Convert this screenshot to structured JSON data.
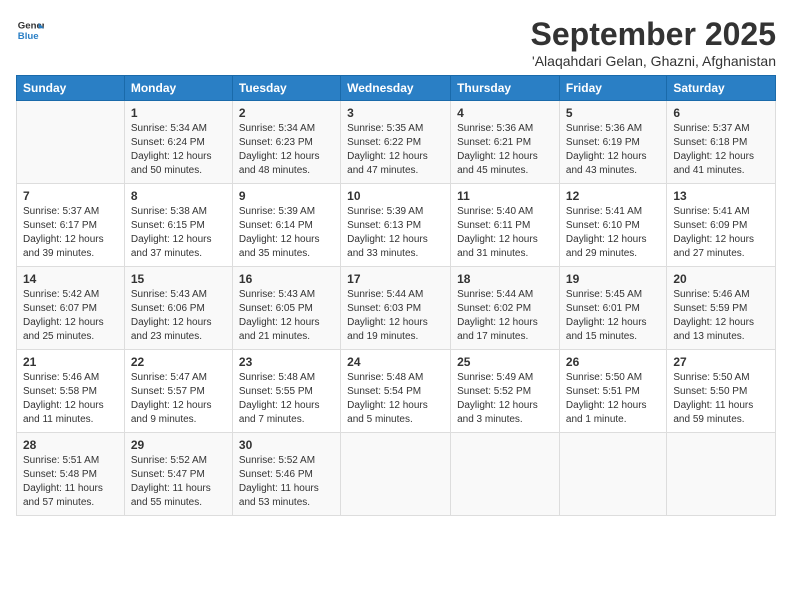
{
  "logo": {
    "line1": "General",
    "line2": "Blue"
  },
  "title": "September 2025",
  "location": "'Alaqahdari Gelan, Ghazni, Afghanistan",
  "days_of_week": [
    "Sunday",
    "Monday",
    "Tuesday",
    "Wednesday",
    "Thursday",
    "Friday",
    "Saturday"
  ],
  "weeks": [
    [
      {
        "day": "",
        "content": ""
      },
      {
        "day": "1",
        "content": "Sunrise: 5:34 AM\nSunset: 6:24 PM\nDaylight: 12 hours\nand 50 minutes."
      },
      {
        "day": "2",
        "content": "Sunrise: 5:34 AM\nSunset: 6:23 PM\nDaylight: 12 hours\nand 48 minutes."
      },
      {
        "day": "3",
        "content": "Sunrise: 5:35 AM\nSunset: 6:22 PM\nDaylight: 12 hours\nand 47 minutes."
      },
      {
        "day": "4",
        "content": "Sunrise: 5:36 AM\nSunset: 6:21 PM\nDaylight: 12 hours\nand 45 minutes."
      },
      {
        "day": "5",
        "content": "Sunrise: 5:36 AM\nSunset: 6:19 PM\nDaylight: 12 hours\nand 43 minutes."
      },
      {
        "day": "6",
        "content": "Sunrise: 5:37 AM\nSunset: 6:18 PM\nDaylight: 12 hours\nand 41 minutes."
      }
    ],
    [
      {
        "day": "7",
        "content": "Sunrise: 5:37 AM\nSunset: 6:17 PM\nDaylight: 12 hours\nand 39 minutes."
      },
      {
        "day": "8",
        "content": "Sunrise: 5:38 AM\nSunset: 6:15 PM\nDaylight: 12 hours\nand 37 minutes."
      },
      {
        "day": "9",
        "content": "Sunrise: 5:39 AM\nSunset: 6:14 PM\nDaylight: 12 hours\nand 35 minutes."
      },
      {
        "day": "10",
        "content": "Sunrise: 5:39 AM\nSunset: 6:13 PM\nDaylight: 12 hours\nand 33 minutes."
      },
      {
        "day": "11",
        "content": "Sunrise: 5:40 AM\nSunset: 6:11 PM\nDaylight: 12 hours\nand 31 minutes."
      },
      {
        "day": "12",
        "content": "Sunrise: 5:41 AM\nSunset: 6:10 PM\nDaylight: 12 hours\nand 29 minutes."
      },
      {
        "day": "13",
        "content": "Sunrise: 5:41 AM\nSunset: 6:09 PM\nDaylight: 12 hours\nand 27 minutes."
      }
    ],
    [
      {
        "day": "14",
        "content": "Sunrise: 5:42 AM\nSunset: 6:07 PM\nDaylight: 12 hours\nand 25 minutes."
      },
      {
        "day": "15",
        "content": "Sunrise: 5:43 AM\nSunset: 6:06 PM\nDaylight: 12 hours\nand 23 minutes."
      },
      {
        "day": "16",
        "content": "Sunrise: 5:43 AM\nSunset: 6:05 PM\nDaylight: 12 hours\nand 21 minutes."
      },
      {
        "day": "17",
        "content": "Sunrise: 5:44 AM\nSunset: 6:03 PM\nDaylight: 12 hours\nand 19 minutes."
      },
      {
        "day": "18",
        "content": "Sunrise: 5:44 AM\nSunset: 6:02 PM\nDaylight: 12 hours\nand 17 minutes."
      },
      {
        "day": "19",
        "content": "Sunrise: 5:45 AM\nSunset: 6:01 PM\nDaylight: 12 hours\nand 15 minutes."
      },
      {
        "day": "20",
        "content": "Sunrise: 5:46 AM\nSunset: 5:59 PM\nDaylight: 12 hours\nand 13 minutes."
      }
    ],
    [
      {
        "day": "21",
        "content": "Sunrise: 5:46 AM\nSunset: 5:58 PM\nDaylight: 12 hours\nand 11 minutes."
      },
      {
        "day": "22",
        "content": "Sunrise: 5:47 AM\nSunset: 5:57 PM\nDaylight: 12 hours\nand 9 minutes."
      },
      {
        "day": "23",
        "content": "Sunrise: 5:48 AM\nSunset: 5:55 PM\nDaylight: 12 hours\nand 7 minutes."
      },
      {
        "day": "24",
        "content": "Sunrise: 5:48 AM\nSunset: 5:54 PM\nDaylight: 12 hours\nand 5 minutes."
      },
      {
        "day": "25",
        "content": "Sunrise: 5:49 AM\nSunset: 5:52 PM\nDaylight: 12 hours\nand 3 minutes."
      },
      {
        "day": "26",
        "content": "Sunrise: 5:50 AM\nSunset: 5:51 PM\nDaylight: 12 hours\nand 1 minute."
      },
      {
        "day": "27",
        "content": "Sunrise: 5:50 AM\nSunset: 5:50 PM\nDaylight: 11 hours\nand 59 minutes."
      }
    ],
    [
      {
        "day": "28",
        "content": "Sunrise: 5:51 AM\nSunset: 5:48 PM\nDaylight: 11 hours\nand 57 minutes."
      },
      {
        "day": "29",
        "content": "Sunrise: 5:52 AM\nSunset: 5:47 PM\nDaylight: 11 hours\nand 55 minutes."
      },
      {
        "day": "30",
        "content": "Sunrise: 5:52 AM\nSunset: 5:46 PM\nDaylight: 11 hours\nand 53 minutes."
      },
      {
        "day": "",
        "content": ""
      },
      {
        "day": "",
        "content": ""
      },
      {
        "day": "",
        "content": ""
      },
      {
        "day": "",
        "content": ""
      }
    ]
  ]
}
